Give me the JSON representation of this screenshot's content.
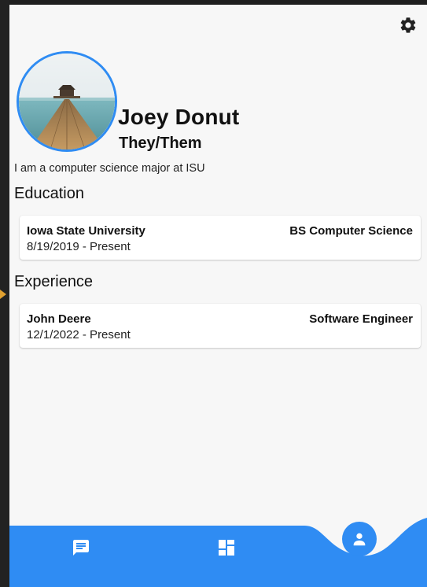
{
  "profile": {
    "name": "Joey Donut",
    "pronouns": "They/Them",
    "bio": "I am a computer science major at ISU"
  },
  "education": {
    "heading": "Education",
    "items": [
      {
        "institution": "Iowa State University",
        "degree": "BS Computer Science",
        "dates": "8/19/2019 - Present"
      }
    ]
  },
  "experience": {
    "heading": "Experience",
    "items": [
      {
        "company": "John Deere",
        "role": "Software Engineer",
        "dates": "12/1/2022 - Present"
      }
    ]
  },
  "icons": {
    "settings": "gear-icon",
    "avatar": "pier-photo",
    "nav_messages": "chat-icon",
    "nav_dashboard": "dashboard-icon",
    "nav_profile": "person-icon"
  },
  "colors": {
    "accent": "#2f8cf3",
    "background": "#f7f7f7",
    "card": "#ffffff"
  }
}
